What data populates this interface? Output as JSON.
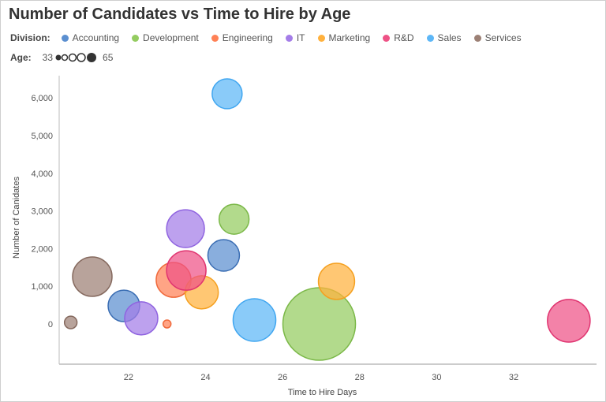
{
  "chart_data": {
    "type": "scatter",
    "subtype": "bubble",
    "title": "Number of Candidates vs Time to Hire by Age",
    "xlabel": "Time to Hire Days",
    "ylabel": "Number of Canidates",
    "xlim": [
      20.2,
      34.15
    ],
    "ylim": [
      -1067,
      6590
    ],
    "xticks": [
      22,
      24,
      26,
      28,
      30,
      32
    ],
    "yticks": [
      0,
      1000,
      2000,
      3000,
      4000,
      5000,
      6000
    ],
    "ytick_labels": [
      "0",
      "1,000",
      "2,000",
      "3,000",
      "4,000",
      "5,000",
      "6,000"
    ],
    "grid": false,
    "color_legend_title": "Division:",
    "size_legend_title": "Age:",
    "size_range": [
      33,
      65
    ],
    "size_min_label": "33",
    "size_max_label": "65",
    "series": [
      {
        "name": "Accounting",
        "color": "#5b8fd0",
        "stroke": "#3a6db3",
        "points": [
          {
            "x": 21.88,
            "y": 480,
            "age": 44.7
          },
          {
            "x": 24.47,
            "y": 1820,
            "age": 44.7
          }
        ]
      },
      {
        "name": "Development",
        "color": "#94cc60",
        "stroke": "#7bb848",
        "points": [
          {
            "x": 24.74,
            "y": 2780,
            "age": 43.9
          },
          {
            "x": 26.95,
            "y": 0,
            "age": 65
          }
        ]
      },
      {
        "name": "Engineering",
        "color": "#ff8156",
        "stroke": "#f06a3c",
        "points": [
          {
            "x": 23.0,
            "y": 0,
            "age": 33
          },
          {
            "x": 23.17,
            "y": 1170,
            "age": 46.3
          }
        ]
      },
      {
        "name": "IT",
        "color": "#a47de8",
        "stroke": "#8f63e0",
        "points": [
          {
            "x": 22.33,
            "y": 150,
            "age": 45.5
          },
          {
            "x": 23.48,
            "y": 2530,
            "age": 47.8
          }
        ]
      },
      {
        "name": "Marketing",
        "color": "#ffb13d",
        "stroke": "#f5a020",
        "points": [
          {
            "x": 23.9,
            "y": 840,
            "age": 45.5
          },
          {
            "x": 27.4,
            "y": 1130,
            "age": 47
          }
        ]
      },
      {
        "name": "R&D",
        "color": "#ee5286",
        "stroke": "#e03470",
        "points": [
          {
            "x": 23.5,
            "y": 1420,
            "age": 48.6
          },
          {
            "x": 33.43,
            "y": 85,
            "age": 50.2
          }
        ]
      },
      {
        "name": "Sales",
        "color": "#5db7f7",
        "stroke": "#40a6f0",
        "points": [
          {
            "x": 24.56,
            "y": 6110,
            "age": 43.9
          },
          {
            "x": 25.27,
            "y": 105,
            "age": 50.2
          }
        ]
      },
      {
        "name": "Services",
        "color": "#9c8075",
        "stroke": "#85695e",
        "points": [
          {
            "x": 20.5,
            "y": 40,
            "age": 35.3
          },
          {
            "x": 21.06,
            "y": 1255,
            "age": 48.6
          }
        ]
      }
    ]
  }
}
